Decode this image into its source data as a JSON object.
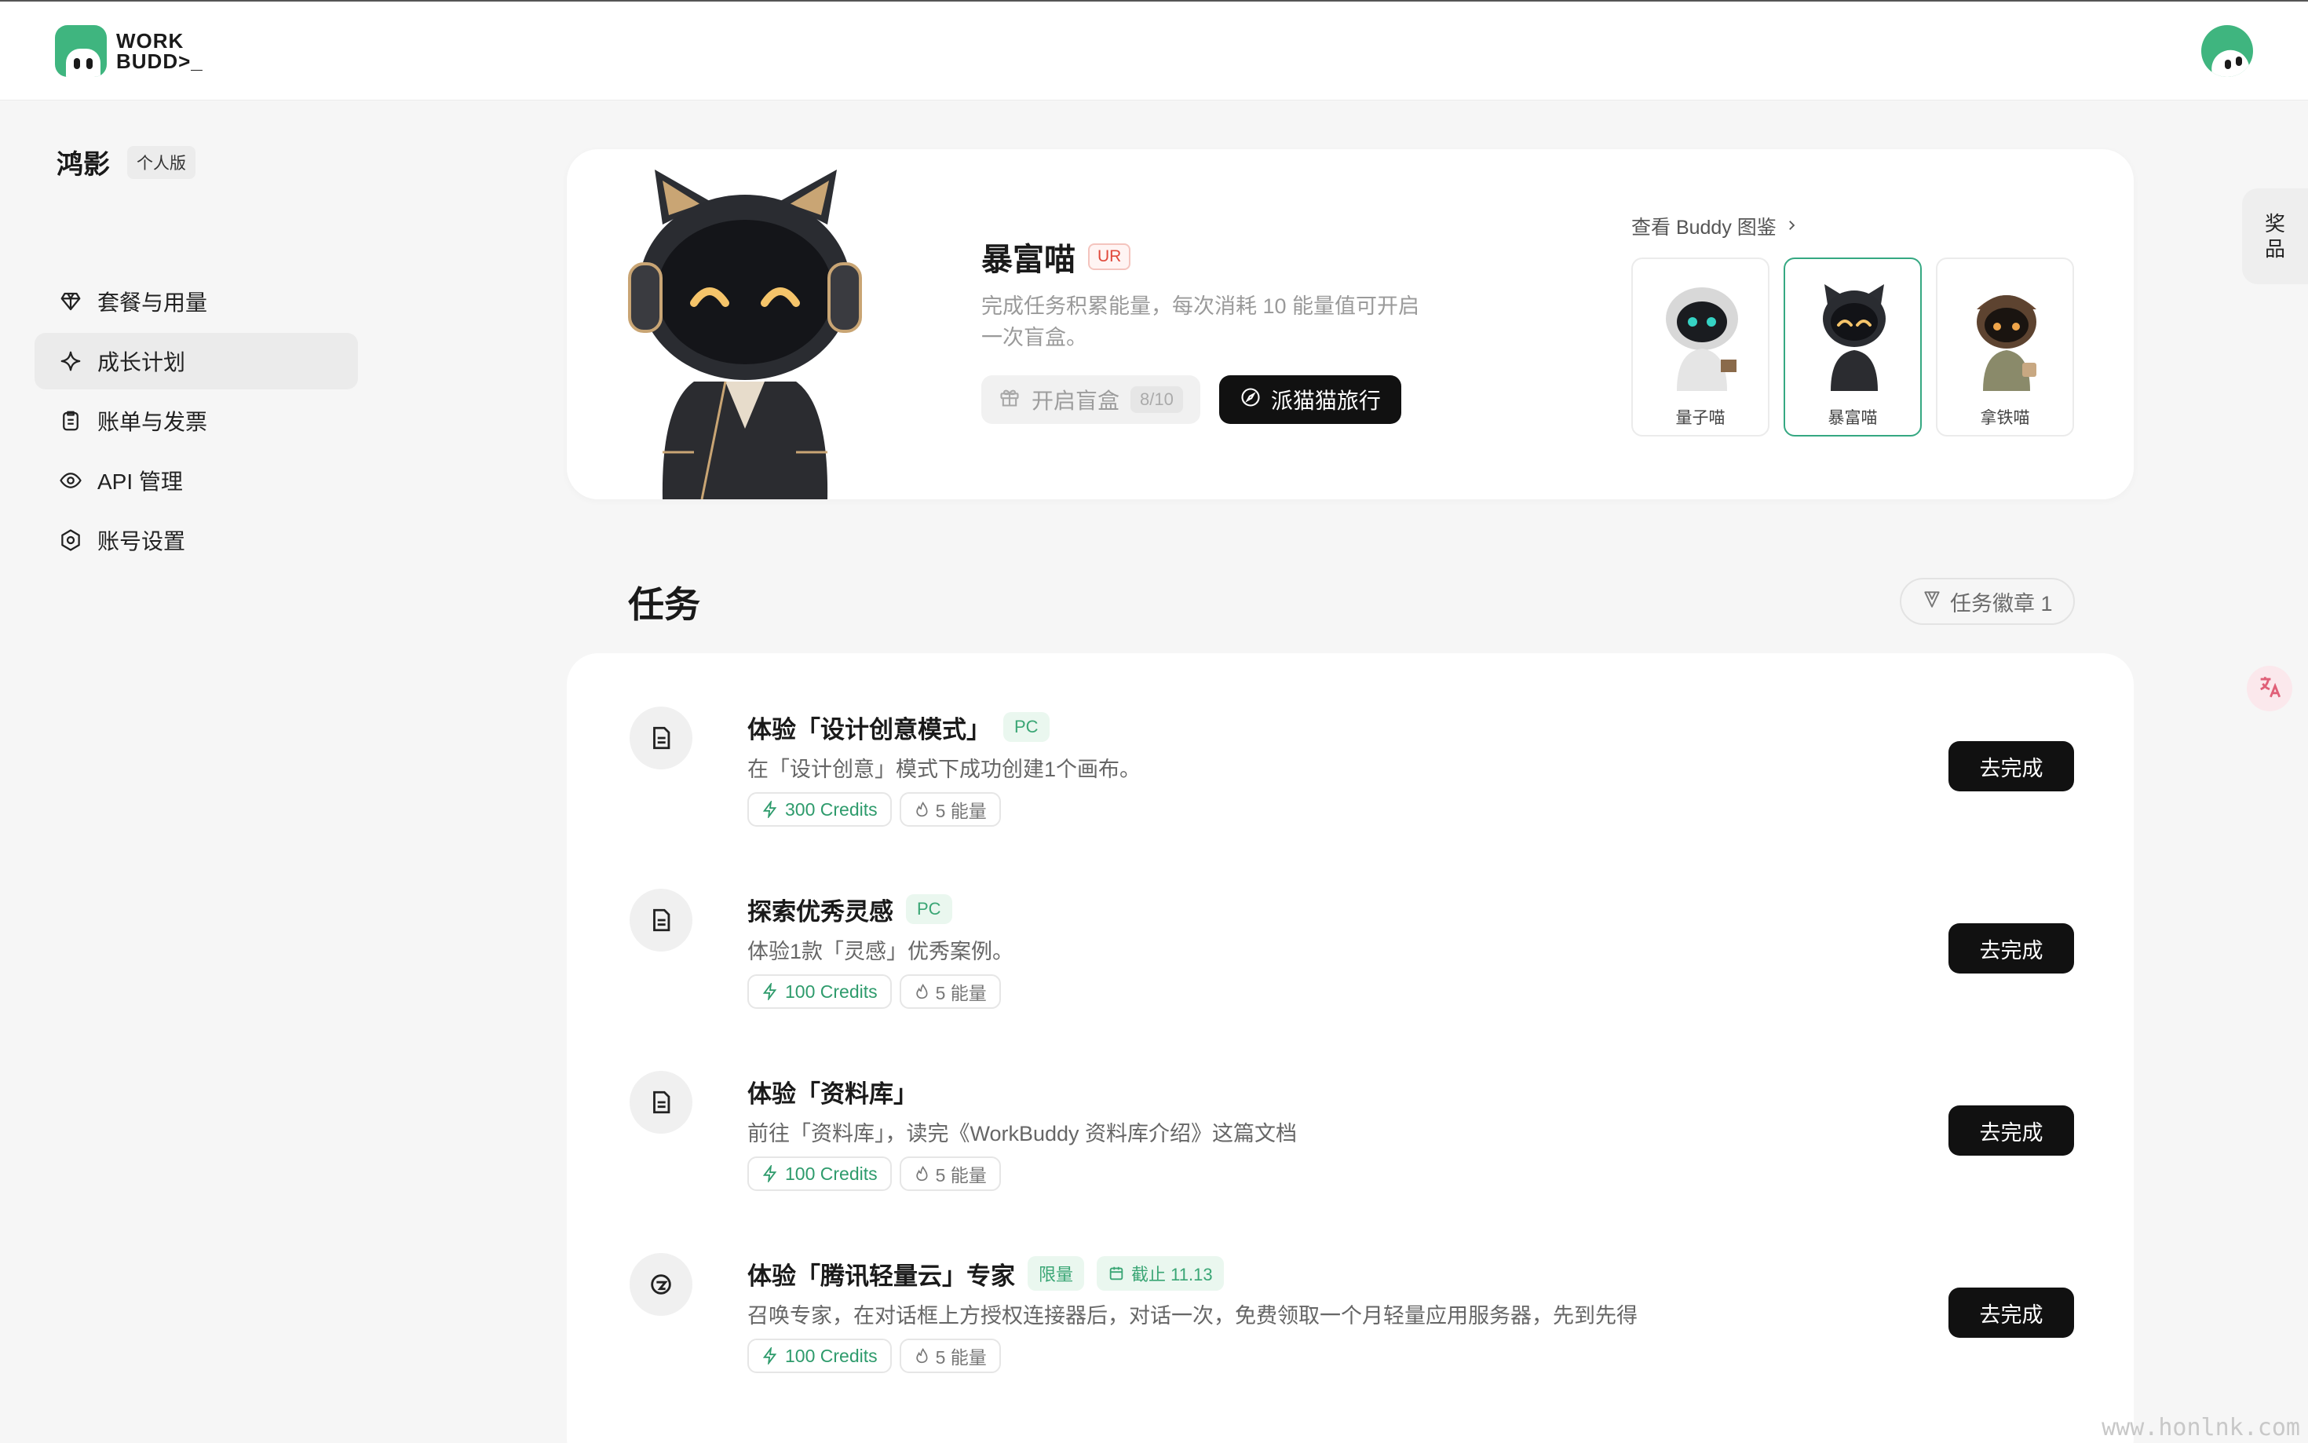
{
  "brand": {
    "logo_line1": "WORK",
    "logo_line2": "BUDD>_"
  },
  "user": {
    "name": "鸿影",
    "plan": "个人版"
  },
  "sidebar": {
    "items": [
      {
        "label": "套餐与用量",
        "icon": "diamond-icon"
      },
      {
        "label": "成长计划",
        "icon": "sparkle-icon",
        "active": true
      },
      {
        "label": "账单与发票",
        "icon": "clipboard-icon"
      },
      {
        "label": "API 管理",
        "icon": "eye-icon"
      },
      {
        "label": "账号设置",
        "icon": "settings-icon"
      }
    ]
  },
  "hero": {
    "name": "暴富喵",
    "rarity": "UR",
    "description": "完成任务积累能量，每次消耗 10 能量值可开启一次盲盒。",
    "open_box_label": "开启盲盒",
    "open_box_count": "8/10",
    "travel_label": "派猫猫旅行",
    "gallery_link": "查看 Buddy 图鉴",
    "buddies": [
      {
        "name": "量子喵"
      },
      {
        "name": "暴富喵",
        "selected": true
      },
      {
        "name": "拿铁喵"
      }
    ]
  },
  "side_tab": {
    "line1": "奖",
    "line2": "品"
  },
  "tasks": {
    "title": "任务",
    "badge_label": "任务徽章 1",
    "items": [
      {
        "title": "体验「设计创意模式」",
        "tag": "PC",
        "desc": "在「设计创意」模式下成功创建1个画布。",
        "credits": "300 Credits",
        "energy": "5 能量",
        "action": "去完成",
        "icon": "document-icon"
      },
      {
        "title": "探索优秀灵感",
        "tag": "PC",
        "desc": "体验1款「灵感」优秀案例。",
        "credits": "100 Credits",
        "energy": "5 能量",
        "action": "去完成",
        "icon": "document-icon"
      },
      {
        "title": "体验「资料库」",
        "desc": "前往「资料库」，读完《WorkBuddy 资料库介绍》这篇文档",
        "credits": "100 Credits",
        "energy": "5 能量",
        "action": "去完成",
        "icon": "document-icon"
      },
      {
        "title": "体验「腾讯轻量云」专家",
        "tag": "限量",
        "deadline": "截止 11.13",
        "desc": "召唤专家，在对话框上方授权连接器后，对话一次，免费领取一个月轻量应用服务器，先到先得",
        "credits": "100 Credits",
        "energy": "5 能量",
        "action": "去完成",
        "icon": "cloud-icon"
      }
    ]
  },
  "watermark": "www.honlnk.com",
  "colors": {
    "accent_green": "#3fb57f",
    "button_dark": "#111111",
    "ur_red": "#e0493b"
  }
}
